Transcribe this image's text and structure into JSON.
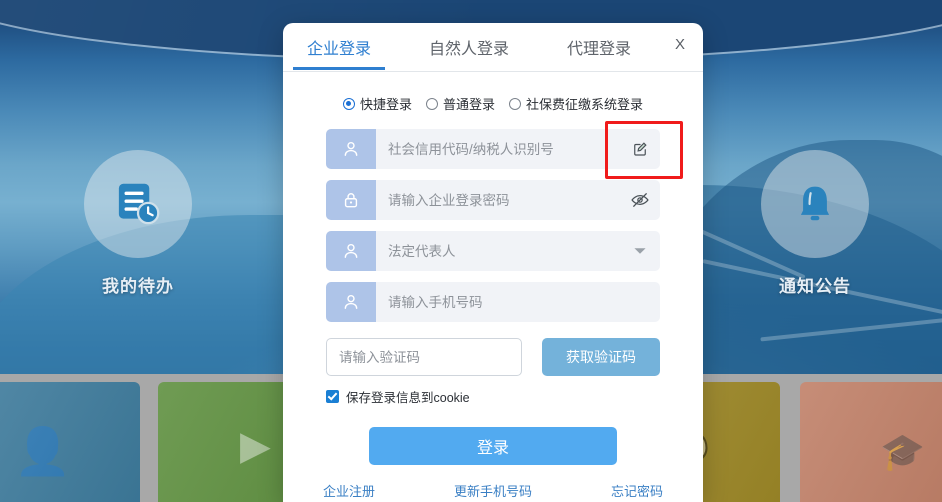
{
  "background": {
    "features": [
      {
        "caption": "我的待办",
        "icon": "document-clock-icon"
      },
      {
        "caption": "通知公告",
        "icon": "bell-icon"
      }
    ],
    "cards": [
      {
        "name": "card-teal",
        "color": "#3d7a9b",
        "glyph": "person-icon"
      },
      {
        "name": "card-green",
        "color": "#5f9040",
        "glyph": "play-icon"
      },
      {
        "name": "card-navy",
        "color": "#4f5b95",
        "glyph": "search-icon"
      },
      {
        "name": "card-olive",
        "color": "#9c8727",
        "glyph": "chat-icon"
      },
      {
        "name": "card-salmon",
        "color": "#c08068",
        "glyph": "graduation-icon"
      }
    ]
  },
  "modal": {
    "close_label": "X",
    "tabs": [
      {
        "label": "企业登录",
        "active": true
      },
      {
        "label": "自然人登录",
        "active": false
      },
      {
        "label": "代理登录",
        "active": false
      }
    ],
    "login_modes": [
      {
        "label": "快捷登录",
        "selected": true
      },
      {
        "label": "普通登录",
        "selected": false
      },
      {
        "label": "社保费征缴系统登录",
        "selected": false
      }
    ],
    "fields": [
      {
        "name": "credit-code-field",
        "icon": "user-icon",
        "placeholder": "社会信用代码/纳税人识别号",
        "value": "",
        "action_icon": "edit-icon",
        "highlighted": true
      },
      {
        "name": "password-field",
        "icon": "lock-icon",
        "placeholder": "请输入企业登录密码",
        "value": "",
        "action_icon": "eye-slash-icon",
        "highlighted": false
      },
      {
        "name": "legal-rep-field",
        "icon": "user-icon",
        "placeholder": "法定代表人",
        "value": "",
        "action_icon": "chevron-down-icon",
        "highlighted": false
      },
      {
        "name": "phone-field",
        "icon": "user-icon",
        "placeholder": "请输入手机号码",
        "value": "",
        "action_icon": "",
        "highlighted": false
      }
    ],
    "captcha": {
      "placeholder": "请输入验证码",
      "value": "",
      "button_label": "获取验证码"
    },
    "cookie": {
      "label": "保存登录信息到cookie",
      "checked": true
    },
    "login_button_label": "登录",
    "links": [
      {
        "label": "企业注册"
      },
      {
        "label": "更新手机号码"
      },
      {
        "label": "忘记密码"
      }
    ]
  },
  "colors": {
    "accent_blue": "#2f7fd0",
    "login_button": "#52aaf0",
    "captcha_button": "#74b2da",
    "highlight_red": "#f01b1b",
    "field_icon_bg": "#aec4e8"
  }
}
